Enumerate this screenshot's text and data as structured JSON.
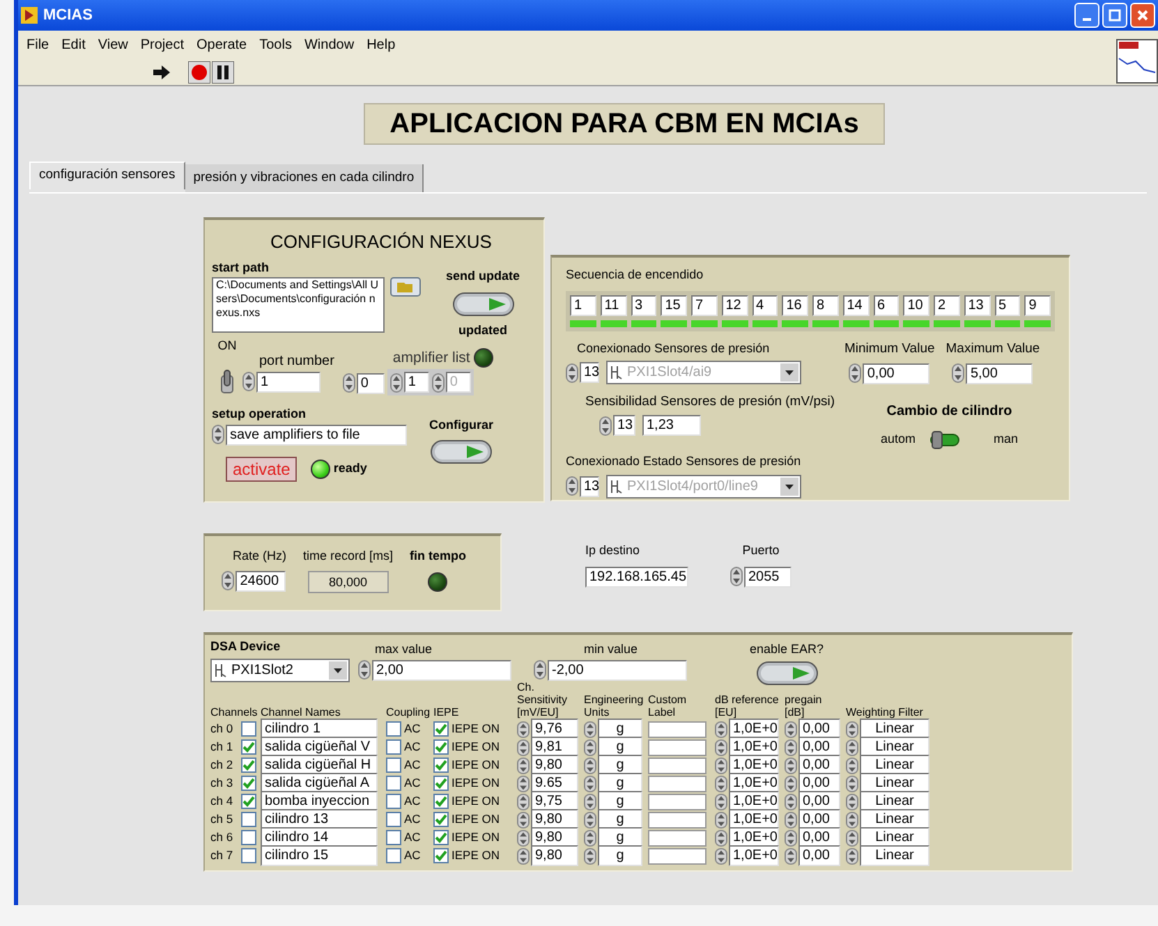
{
  "window": {
    "title": "MCIAS"
  },
  "menu": [
    "File",
    "Edit",
    "View",
    "Project",
    "Operate",
    "Tools",
    "Window",
    "Help"
  ],
  "banner": "APLICACION PARA CBM EN MCIAs",
  "tabs": [
    {
      "label": "configuración sensores",
      "selected": true
    },
    {
      "label": "presión y vibraciones en cada cilindro",
      "selected": false
    }
  ],
  "nexus": {
    "title": "CONFIGURACIÓN NEXUS",
    "start_path_label": "start path",
    "start_path": "C:\\Documents and Settings\\All Users\\Documents\\configuración nexus.nxs",
    "switch_label": "ON",
    "switch_on": true,
    "port_number_label": "port number",
    "port_number": "1",
    "amplifier_index": "0",
    "amplifier_list_label": "amplifier list",
    "amplifier_list": [
      {
        "value": "1",
        "disabled": false
      },
      {
        "value": "0",
        "disabled": true
      }
    ],
    "setup_operation_label": "setup operation",
    "setup_operation": "save amplifiers to file",
    "activate": "activate",
    "ready_label": "ready",
    "ready_on": true,
    "send_update": "send update",
    "updated_label": "updated",
    "updated_on": false,
    "configurar": "Configurar"
  },
  "sequence": {
    "label": "Secuencia de encendido",
    "items": [
      {
        "value": "1",
        "on": true
      },
      {
        "value": "11",
        "on": true
      },
      {
        "value": "3",
        "on": true
      },
      {
        "value": "15",
        "on": true
      },
      {
        "value": "7",
        "on": true
      },
      {
        "value": "12",
        "on": true
      },
      {
        "value": "4",
        "on": true
      },
      {
        "value": "16",
        "on": true
      },
      {
        "value": "8",
        "on": true
      },
      {
        "value": "14",
        "on": true
      },
      {
        "value": "6",
        "on": true
      },
      {
        "value": "10",
        "on": true
      },
      {
        "value": "2",
        "on": true
      },
      {
        "value": "13",
        "on": true
      },
      {
        "value": "5",
        "on": true
      },
      {
        "value": "9",
        "on": true
      }
    ]
  },
  "pressure": {
    "sensors_label": "Conexionado Sensores de presión",
    "sensors_index": "13",
    "sensors_channel": "PXI1Slot4/ai9",
    "min_label": "Minimum Value",
    "min": "0,00",
    "max_label": "Maximum Value",
    "max": "5,00",
    "sens_label": "Sensibilidad Sensores de presión (mV/psi)",
    "sens_index": "13",
    "sens": "1,23",
    "cambio_label": "Cambio de cilindro",
    "cambio_left": "autom",
    "cambio_right": "man",
    "cambio_manual": false,
    "estado_label": "Conexionado Estado Sensores de presión",
    "estado_index": "13",
    "estado_channel": "PXI1Slot4/port0/line9"
  },
  "timing": {
    "rate_label": "Rate (Hz)",
    "rate": "24600",
    "time_label": "time record [ms]",
    "time": "80,000",
    "fin_label": "fin tempo",
    "fin_on": false
  },
  "network": {
    "ip_label": "Ip destino",
    "ip": "192.168.165.45",
    "port_label": "Puerto",
    "port": "2055"
  },
  "dsa": {
    "device_label": "DSA Device",
    "device": "PXI1Slot2",
    "max_label": "max value",
    "max": "2,00",
    "min_label": "min value",
    "min": "-2,00",
    "ear_label": "enable EAR?",
    "columns": [
      "Channels",
      "Channel Names",
      "Coupling",
      "IEPE",
      "Ch. Sensitivity [mV/EU]",
      "Engineering Units",
      "Custom Label",
      "dB reference [EU]",
      "pregain [dB]",
      "Weighting Filter"
    ],
    "rows": [
      {
        "channel": "ch 0",
        "checked": false,
        "name": "cilindro 1",
        "coupling": "AC",
        "ac": false,
        "iepe": "IEPE ON",
        "iepe_on": true,
        "sensitivity": "9,76",
        "units": "g",
        "db_ref": "1,0E+0",
        "pregain": "0,00",
        "filter": "Linear"
      },
      {
        "channel": "ch 1",
        "checked": true,
        "name": "salida cigüeñal V",
        "coupling": "AC",
        "ac": false,
        "iepe": "IEPE ON",
        "iepe_on": true,
        "sensitivity": "9,81",
        "units": "g",
        "db_ref": "1,0E+0",
        "pregain": "0,00",
        "filter": "Linear"
      },
      {
        "channel": "ch 2",
        "checked": true,
        "name": "salida cigüeñal H",
        "coupling": "AC",
        "ac": false,
        "iepe": "IEPE ON",
        "iepe_on": true,
        "sensitivity": "9,80",
        "units": "g",
        "db_ref": "1,0E+0",
        "pregain": "0,00",
        "filter": "Linear"
      },
      {
        "channel": "ch 3",
        "checked": true,
        "name": "salida cigüeñal A",
        "coupling": "AC",
        "ac": false,
        "iepe": "IEPE ON",
        "iepe_on": true,
        "sensitivity": "9.65",
        "units": "g",
        "db_ref": "1,0E+0",
        "pregain": "0,00",
        "filter": "Linear"
      },
      {
        "channel": "ch 4",
        "checked": true,
        "name": "bomba inyeccion",
        "coupling": "AC",
        "ac": false,
        "iepe": "IEPE ON",
        "iepe_on": true,
        "sensitivity": "9,75",
        "units": "g",
        "db_ref": "1,0E+0",
        "pregain": "0,00",
        "filter": "Linear"
      },
      {
        "channel": "ch 5",
        "checked": false,
        "name": "cilindro 13",
        "coupling": "AC",
        "ac": false,
        "iepe": "IEPE ON",
        "iepe_on": true,
        "sensitivity": "9,80",
        "units": "g",
        "db_ref": "1,0E+0",
        "pregain": "0,00",
        "filter": "Linear"
      },
      {
        "channel": "ch 6",
        "checked": false,
        "name": "cilindro 14",
        "coupling": "AC",
        "ac": false,
        "iepe": "IEPE ON",
        "iepe_on": true,
        "sensitivity": "9,80",
        "units": "g",
        "db_ref": "1,0E+0",
        "pregain": "0,00",
        "filter": "Linear"
      },
      {
        "channel": "ch 7",
        "checked": false,
        "name": "cilindro 15",
        "coupling": "AC",
        "ac": false,
        "iepe": "IEPE ON",
        "iepe_on": true,
        "sensitivity": "9,80",
        "units": "g",
        "db_ref": "1,0E+0",
        "pregain": "0,00",
        "filter": "Linear"
      }
    ]
  }
}
